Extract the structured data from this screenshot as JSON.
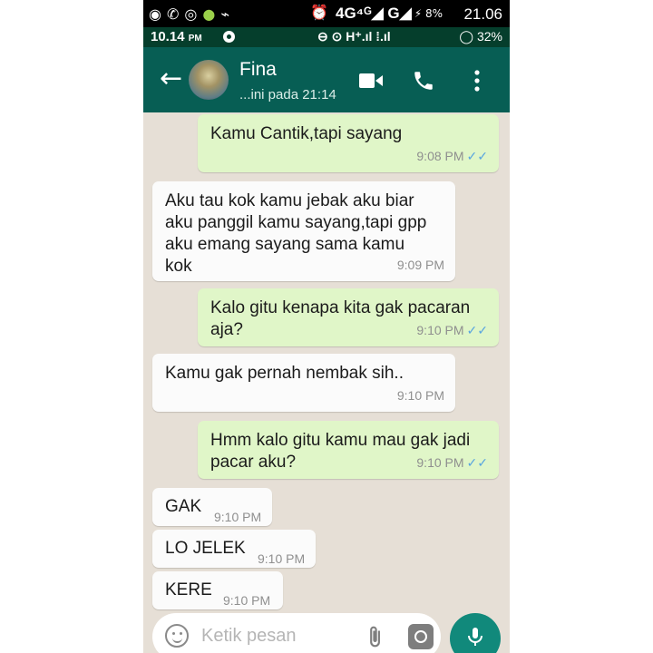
{
  "status_outer": {
    "net": "4G⁴ᴳ◢ G◢",
    "battery": "⚡ 8%",
    "time": "21.06"
  },
  "status_inner": {
    "time": "10.14",
    "time_suffix": "PM",
    "signal": "⊖ ⊙ H⁺.ıl ⁞.ıl",
    "battery": "◯ 32%"
  },
  "contact": {
    "name": "Fina",
    "status": "...ini pada 21:14"
  },
  "colors": {
    "header": "#075e54",
    "outgoing": "#e0f6c8",
    "incoming": "#fbfbfb",
    "background": "#e6dfd6",
    "ticks": "#5aa6df",
    "mic_button": "#11897b"
  },
  "messages": [
    {
      "dir": "out",
      "lines": [
        "Kamu Cantik,tapi sayang"
      ],
      "time": "9:08 PM",
      "ticks": "✓✓"
    },
    {
      "dir": "in",
      "lines": [
        "Aku tau kok kamu jebak aku biar",
        "aku panggil kamu sayang,tapi gpp",
        "aku emang sayang sama kamu",
        "kok"
      ],
      "time": "9:09 PM"
    },
    {
      "dir": "out",
      "lines": [
        "Kalo gitu kenapa kita gak pacaran",
        "aja?"
      ],
      "time": "9:10 PM",
      "ticks": "✓✓"
    },
    {
      "dir": "in",
      "lines": [
        "Kamu gak pernah nembak sih.."
      ],
      "time": "9:10 PM"
    },
    {
      "dir": "out",
      "lines": [
        "Hmm kalo gitu kamu mau gak jadi",
        "pacar aku?"
      ],
      "time": "9:10 PM",
      "ticks": "✓✓"
    },
    {
      "dir": "in",
      "lines": [
        "GAK"
      ],
      "time": "9:10 PM"
    },
    {
      "dir": "in",
      "lines": [
        "LO JELEK"
      ],
      "time": "9:10 PM"
    },
    {
      "dir": "in",
      "lines": [
        "KERE"
      ],
      "time": "9:10 PM"
    }
  ],
  "input": {
    "placeholder": "Ketik pesan"
  }
}
